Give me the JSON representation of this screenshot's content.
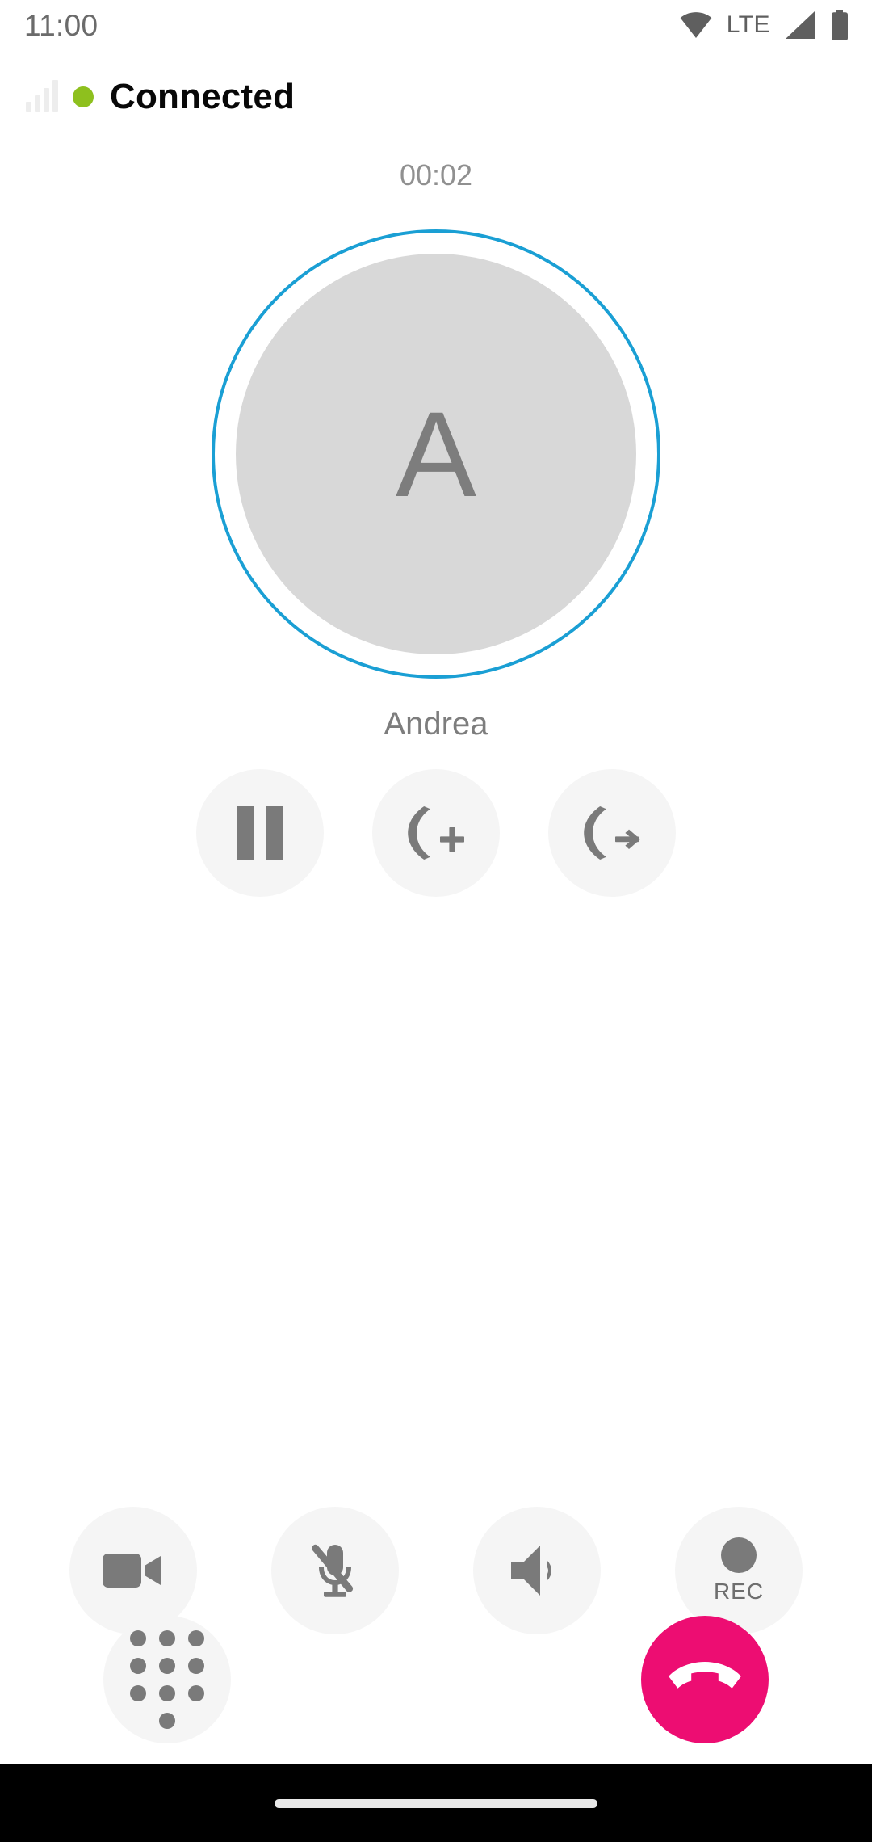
{
  "statusbar": {
    "time": "11:00",
    "network_label": "LTE",
    "icons": [
      "wifi-icon",
      "signal-triangle-icon",
      "battery-icon"
    ]
  },
  "header": {
    "status_text": "Connected",
    "status_dot_color": "#8ec01e",
    "signal_icon": "signal-bars-icon"
  },
  "call": {
    "duration": "00:02",
    "contact_name": "Andrea",
    "avatar_initial": "A",
    "avatar_ring_color": "#1a9fd4",
    "avatar_bg_color": "#d8d8d8"
  },
  "mid_actions": [
    {
      "name": "hold-button",
      "icon": "pause-icon",
      "label": ""
    },
    {
      "name": "add-call-button",
      "icon": "phone-plus-icon",
      "label": ""
    },
    {
      "name": "transfer-call-button",
      "icon": "phone-arrow-icon",
      "label": ""
    }
  ],
  "bottom_controls": [
    {
      "name": "video-button",
      "icon": "video-camera-icon",
      "label": ""
    },
    {
      "name": "mute-button",
      "icon": "mic-off-icon",
      "label": ""
    },
    {
      "name": "speaker-button",
      "icon": "speaker-icon",
      "label": ""
    },
    {
      "name": "record-button",
      "icon": "record-dot-icon",
      "label": "REC"
    },
    {
      "name": "dialpad-button",
      "icon": "dialpad-icon",
      "label": ""
    },
    {
      "name": "hangup-button",
      "icon": "phone-down-icon",
      "label": ""
    }
  ],
  "colors": {
    "hangup": "#ed0d72",
    "control_bg": "#f5f5f5",
    "icon_gray": "#7a7a7a",
    "accent_blue": "#1a9fd4"
  },
  "navbar": {
    "gesture_pill": "home-gesture-pill"
  }
}
